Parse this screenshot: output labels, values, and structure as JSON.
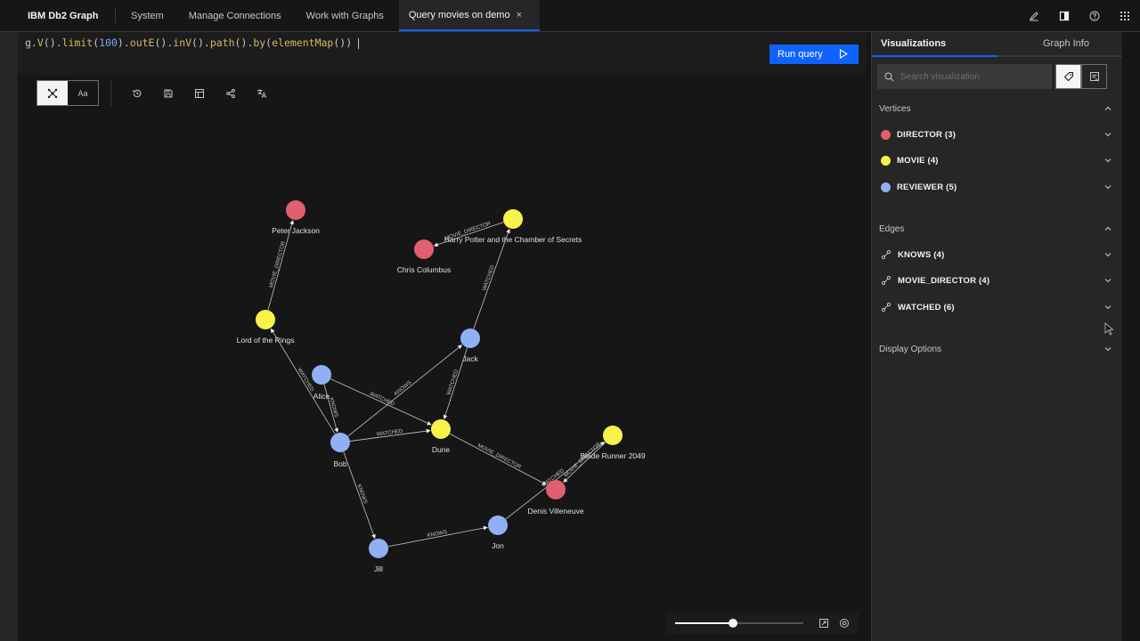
{
  "app": {
    "title": "IBM Db2 Graph"
  },
  "nav": {
    "items": [
      {
        "label": "System"
      },
      {
        "label": "Manage Connections"
      },
      {
        "label": "Work with Graphs"
      }
    ],
    "active_tab": {
      "label": "Query movies on demo",
      "close": "×"
    }
  },
  "header_icons": [
    "edit-icon",
    "panel-icon",
    "help-icon",
    "app-switcher-icon"
  ],
  "query": {
    "text": "g.V().limit(100).outE().inV().path().by(elementMap())",
    "run_label": "Run query"
  },
  "toolbar": {
    "view_toggle": {
      "graph_icon": "graph-view-icon",
      "text_label": "Aa"
    },
    "icons": [
      "history-icon",
      "save-icon",
      "table-icon",
      "share-icon",
      "translate-icon"
    ]
  },
  "colors": {
    "director": "#e06070",
    "movie": "#f8f24a",
    "reviewer": "#8fb1f4",
    "accent": "#0f62fe"
  },
  "graph": {
    "nodes": [
      {
        "id": "peter",
        "label": "Peter Jackson",
        "type": "director"
      },
      {
        "id": "chris",
        "label": "Chris Columbus",
        "type": "director"
      },
      {
        "id": "denis",
        "label": "Denis Villeneuve",
        "type": "director"
      },
      {
        "id": "hp",
        "label": "Harry Potter and the Chamber of Secrets",
        "type": "movie"
      },
      {
        "id": "lotr",
        "label": "Lord of the Rings",
        "type": "movie"
      },
      {
        "id": "dune",
        "label": "Dune",
        "type": "movie"
      },
      {
        "id": "br",
        "label": "Blade Runner 2049",
        "type": "movie"
      },
      {
        "id": "alice",
        "label": "Alice",
        "type": "reviewer"
      },
      {
        "id": "bob",
        "label": "Bob",
        "type": "reviewer"
      },
      {
        "id": "jack",
        "label": "Jack",
        "type": "reviewer"
      },
      {
        "id": "jill",
        "label": "Jill",
        "type": "reviewer"
      },
      {
        "id": "jon",
        "label": "Jon",
        "type": "reviewer"
      }
    ],
    "edges": [
      {
        "from": "lotr",
        "to": "peter",
        "label": "MOVIE_DIRECTOR"
      },
      {
        "from": "hp",
        "to": "chris",
        "label": "MOVIE_DIRECTOR"
      },
      {
        "from": "jack",
        "to": "hp",
        "label": "WATCHED"
      },
      {
        "from": "bob",
        "to": "lotr",
        "label": "WATCHED"
      },
      {
        "from": "alice",
        "to": "bob",
        "label": "KNOWS"
      },
      {
        "from": "alice",
        "to": "dune",
        "label": "WATCHED"
      },
      {
        "from": "bob",
        "to": "jack",
        "label": "KNOWS"
      },
      {
        "from": "jack",
        "to": "dune",
        "label": "WATCHED"
      },
      {
        "from": "bob",
        "to": "dune",
        "label": "WATCHED"
      },
      {
        "from": "dune",
        "to": "denis",
        "label": "MOVIE_DIRECTOR"
      },
      {
        "from": "bob",
        "to": "jill",
        "label": "KNOWS"
      },
      {
        "from": "jill",
        "to": "jon",
        "label": "KNOWS"
      },
      {
        "from": "jon",
        "to": "br",
        "label": "WATCHED"
      },
      {
        "from": "br",
        "to": "denis",
        "label": "MOVIE_DIRECTOR"
      }
    ]
  },
  "zoom": {
    "level": 0.45,
    "icons": [
      "fit-icon",
      "center-icon"
    ]
  },
  "panel": {
    "tabs": [
      {
        "label": "Visualizations"
      },
      {
        "label": "Graph Info"
      }
    ],
    "search_placeholder": "Search visualization",
    "vertices_title": "Vertices",
    "vertices": [
      {
        "label": "DIRECTOR (3)",
        "color": "#e06070"
      },
      {
        "label": "MOVIE (4)",
        "color": "#f8f24a"
      },
      {
        "label": "REVIEWER (5)",
        "color": "#8fb1f4"
      }
    ],
    "edges_title": "Edges",
    "edges": [
      {
        "label": "KNOWS (4)"
      },
      {
        "label": "MOVIE_DIRECTOR (4)"
      },
      {
        "label": "WATCHED (6)"
      }
    ],
    "display_options": "Display Options"
  }
}
